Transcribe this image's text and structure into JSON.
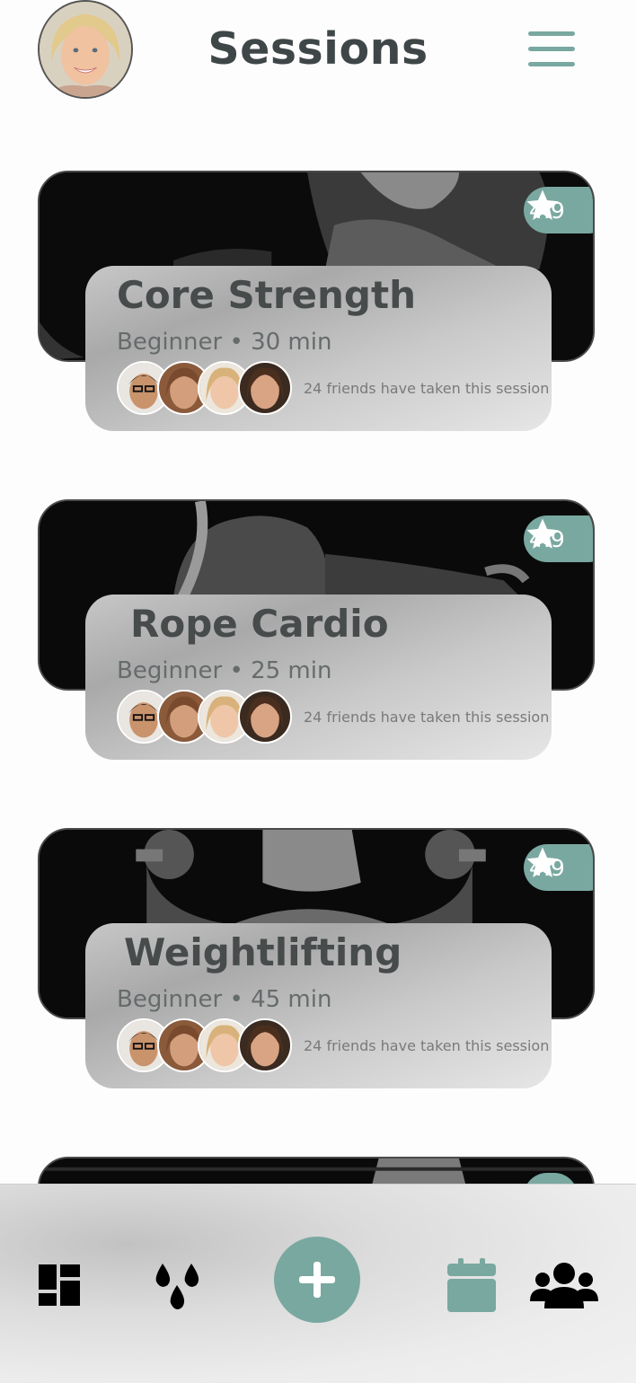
{
  "header": {
    "title": "Sessions",
    "avatar": "user-avatar",
    "menu_icon": "hamburger-menu-icon"
  },
  "sessions": [
    {
      "title": "Core Strength",
      "meta": "Beginner • 30 min",
      "rating": "4.9",
      "friends_text": "24 friends have taken this session",
      "image": "muscular-man-boxing-photo"
    },
    {
      "title": "Rope Cardio",
      "meta": "Beginner • 25 min",
      "rating": "4.9",
      "friends_text": "24 friends have taken this session",
      "image": "battle-rope-workout-photo"
    },
    {
      "title": "Weightlifting",
      "meta": "Beginner • 45 min",
      "rating": "4.9",
      "friends_text": "24 friends have taken this session",
      "image": "woman-dumbbell-press-photo"
    }
  ],
  "nav": {
    "items": [
      "dashboard-icon",
      "water-drops-icon",
      "add-icon",
      "calendar-icon",
      "group-icon"
    ]
  },
  "colors": {
    "accent": "#79a8a0",
    "title_text": "#3f4648",
    "card_dark": "#0c0c0c"
  }
}
